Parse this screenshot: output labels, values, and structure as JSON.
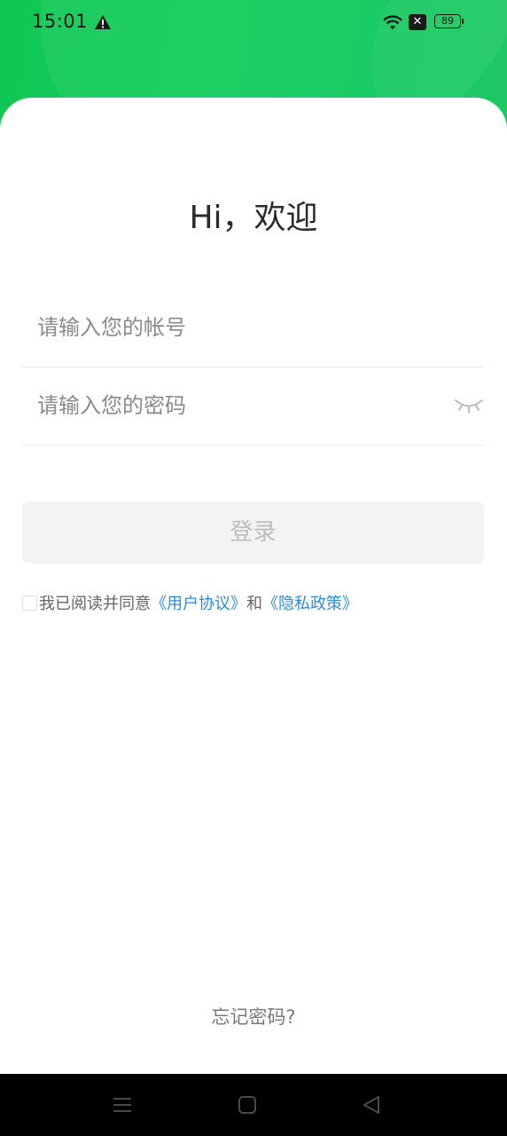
{
  "status_bar": {
    "time": "15:01",
    "battery_level": "89",
    "icons": [
      "warning-icon",
      "wifi-icon",
      "no-sim-icon",
      "battery-icon"
    ],
    "no_sim_glyph": "✕"
  },
  "login": {
    "greeting": "Hi，欢迎",
    "account_placeholder": "请输入您的帐号",
    "account_value": "",
    "password_placeholder": "请输入您的密码",
    "password_value": "",
    "password_toggle_icon": "eye-closed-icon",
    "login_button": "登录",
    "agreement": {
      "checked": false,
      "prefix": "我已阅读并同意",
      "user_agreement": "《用户协议》",
      "conjunction": "和",
      "privacy_policy": "《隐私政策》"
    },
    "forgot_password": "忘记密码?"
  },
  "nav_bar": {
    "buttons": [
      "menu-icon",
      "home-icon",
      "back-icon"
    ]
  },
  "colors": {
    "header_green": "#10c653",
    "link_blue": "#2d8cd6",
    "button_disabled_bg": "#f3f3f3",
    "button_disabled_text": "#bcbcbc"
  }
}
